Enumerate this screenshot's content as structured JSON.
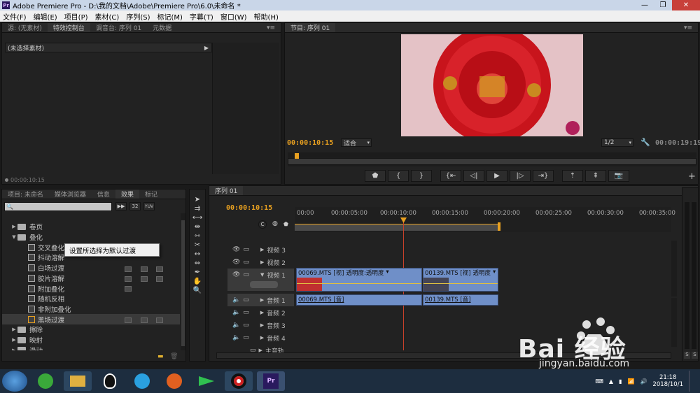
{
  "window": {
    "title": "Adobe Premiere Pro - D:\\我的文档\\Adobe\\Premiere Pro\\6.0\\未命名 *",
    "app_icon": "Pr"
  },
  "menu": [
    "文件(F)",
    "编辑(E)",
    "项目(P)",
    "素材(C)",
    "序列(S)",
    "标记(M)",
    "字幕(T)",
    "窗口(W)",
    "帮助(H)"
  ],
  "source_panel": {
    "tabs": [
      "源: (无素材)",
      "特效控制台",
      "调音台: 序列 01",
      "元数据"
    ],
    "no_clip": "(未选择素材)",
    "timecode": "00:00:10:15"
  },
  "program_monitor": {
    "tab": "节目: 序列 01",
    "timecode": "00:00:10:15",
    "fit": "适合",
    "resolution": "1/2",
    "duration": "00:00:19:19"
  },
  "project_panel": {
    "tabs": [
      "项目: 未命名",
      "媒体浏览器",
      "信息",
      "效果",
      "标记"
    ],
    "filter_icons": [
      "32",
      "YUV"
    ],
    "items": [
      {
        "type": "folder",
        "label": "卷页",
        "expanded": false,
        "indent": 1
      },
      {
        "type": "folder",
        "label": "叠化",
        "expanded": true,
        "indent": 1
      },
      {
        "type": "effect",
        "label": "交叉叠化（标准）"
      },
      {
        "type": "effect",
        "label": "抖动溶解"
      },
      {
        "type": "effect",
        "label": "白场过渡"
      },
      {
        "type": "effect",
        "label": "胶片溶解"
      },
      {
        "type": "effect",
        "label": "附加叠化"
      },
      {
        "type": "effect",
        "label": "随机反相"
      },
      {
        "type": "effect",
        "label": "非附加叠化"
      },
      {
        "type": "effect",
        "label": "黑场过渡",
        "selected": true
      },
      {
        "type": "folder",
        "label": "擦除",
        "expanded": false,
        "indent": 1
      },
      {
        "type": "folder",
        "label": "映射",
        "expanded": false,
        "indent": 1
      },
      {
        "type": "folder",
        "label": "滑动",
        "expanded": false,
        "indent": 1
      }
    ],
    "context_menu": "设置所选择为默认过渡"
  },
  "timeline": {
    "tab": "序列 01",
    "timecode": "00:00:10:15",
    "ruler": [
      "00:00",
      "00:00:05:00",
      "00:00:10:00",
      "00:00:15:00",
      "00:00:20:00",
      "00:00:25:00",
      "00:00:30:00",
      "00:00:35:00"
    ],
    "tracks": {
      "video": [
        "视频 3",
        "视频 2",
        "视频 1"
      ],
      "audio": [
        "音频 1",
        "音频 2",
        "音频 3",
        "音频 4",
        "主音轨"
      ]
    },
    "video_clips": [
      {
        "name": "00069.MTS [视]",
        "effect": "透明度:透明度"
      },
      {
        "name": "00139.MTS [视]",
        "effect": "透明度"
      }
    ],
    "audio_clips": [
      {
        "name": "00069.MTS [音]"
      },
      {
        "name": "00139.MTS [音]"
      }
    ],
    "meter_labels": [
      "S",
      "S"
    ]
  },
  "taskbar": {
    "clock": "21:18",
    "date": "2018/10/1"
  },
  "watermark": {
    "text": "Bai 经验",
    "url": "jingyan.baidu.com"
  },
  "colors": {
    "timecode": "#e8a020",
    "clip": "#6f8fc8",
    "playhead": "#c8402a"
  }
}
